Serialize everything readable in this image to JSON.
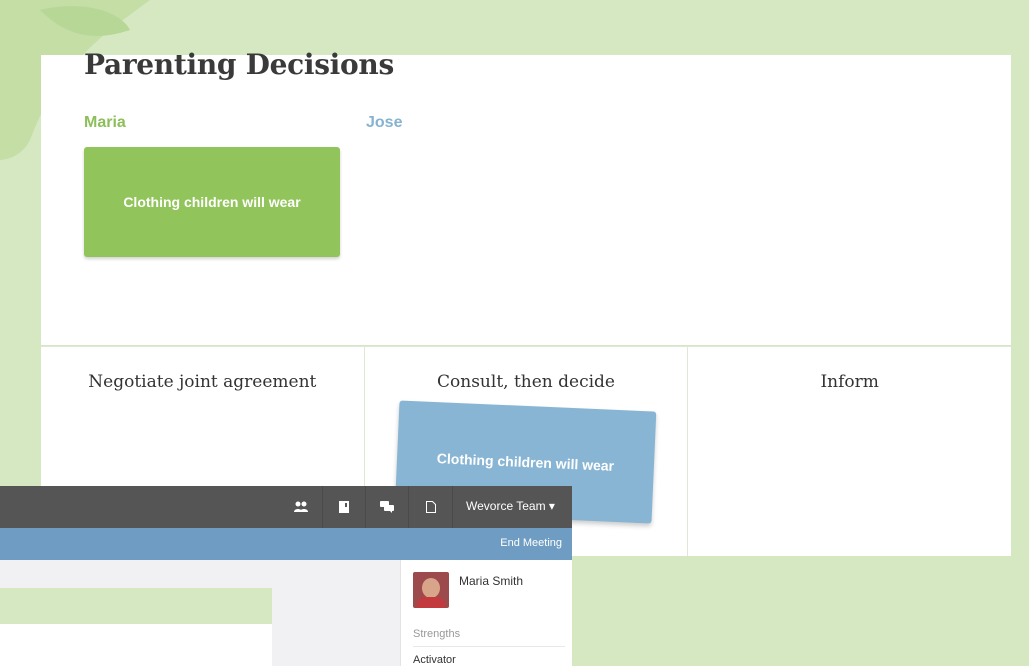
{
  "title": "Parenting Decisions",
  "people": {
    "left": "Maria",
    "right": "Jose"
  },
  "cards": {
    "maria_card": "Clothing children will wear",
    "jose_card": "Clothing children will wear"
  },
  "columns": [
    "Negotiate joint agreement",
    "Consult, then decide",
    "Inform"
  ],
  "app": {
    "team_menu": "Wevorce Team ▾",
    "end_meeting": "End Meeting",
    "profile_name": "Maria Smith",
    "strengths_label": "Strengths",
    "strengths": [
      "Activator"
    ],
    "icons": {
      "people": "people-icon",
      "book": "book-icon",
      "chat": "chat-icon",
      "document": "document-icon"
    }
  },
  "colors": {
    "background": "#d6e8c2",
    "maria_green": "#92c45c",
    "jose_blue": "#88b5d4",
    "topbar": "#555555",
    "bluebar": "#6f9cc2"
  }
}
